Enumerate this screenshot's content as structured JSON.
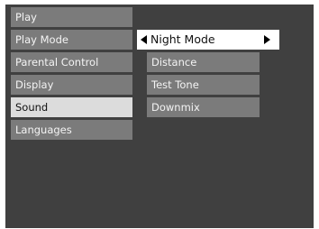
{
  "left_menu": {
    "items": [
      {
        "label": "Play"
      },
      {
        "label": "Play Mode"
      },
      {
        "label": "Parental Control"
      },
      {
        "label": "Display"
      },
      {
        "label": "Sound",
        "selected": true
      },
      {
        "label": "Languages"
      }
    ]
  },
  "sub_menu": {
    "items": [
      {
        "label": "Night Mode",
        "active": true,
        "icon_left": "triangle-left-icon",
        "icon_right": "triangle-right-icon"
      },
      {
        "label": "Distance"
      },
      {
        "label": "Test Tone"
      },
      {
        "label": "Downmix"
      }
    ]
  },
  "colors": {
    "background": "#404040",
    "item": "#7b7b7b",
    "selected_item": "#dcdcdc",
    "active_subitem": "#ffffff"
  }
}
